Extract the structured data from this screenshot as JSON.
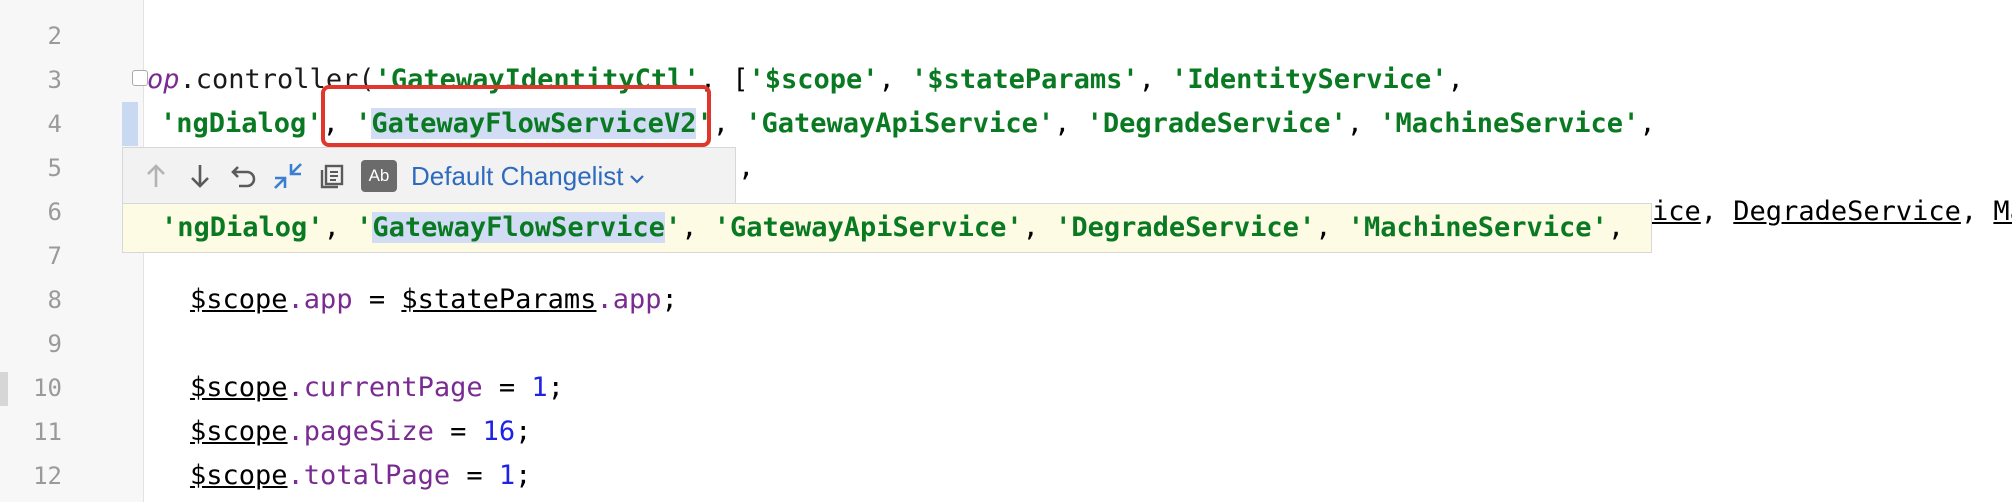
{
  "editor": {
    "line_numbers": [
      "2",
      "3",
      "4",
      "5",
      "6",
      "7",
      "8",
      "9",
      "10",
      "11",
      "12"
    ],
    "line3": {
      "prefix": "op",
      "dot_controller": ".controller(",
      "s1": "'GatewayIdentityCtl'",
      "mid": ", [",
      "s2": "'$scope'",
      "c1": ", ",
      "s3": "'$stateParams'",
      "c2": ", ",
      "s4": "'IdentityService'",
      "tail": ","
    },
    "line4": {
      "s1": "'ngDialog'",
      "c1": ", ",
      "s2_q1": "'",
      "s2_body": "GatewayFlowServiceV2",
      "s2_q2": "'",
      "c2": ", ",
      "s3": "'GatewayApiService'",
      "c3": ", ",
      "s4": "'DegradeService'",
      "c4": ", ",
      "s5": "'MachineService'",
      "tail": ","
    },
    "line5_tail": ",",
    "line6_tail": {
      "t1": "ice",
      "c1": ", ",
      "t2": "DegradeService",
      "c2": ", ",
      "t3": "Ma"
    },
    "line8": {
      "v1": "$scope",
      "p1": ".app",
      "op": " = ",
      "v2": "$stateParams",
      "p2": ".app",
      "end": ";"
    },
    "line10": {
      "v1": "$scope",
      "p1": ".currentPage",
      "op": " = ",
      "n": "1",
      "end": ";"
    },
    "line11": {
      "v1": "$scope",
      "p1": ".pageSize",
      "op": " = ",
      "n": "16",
      "end": ";"
    },
    "line12": {
      "v1": "$scope",
      "p1": ".totalPage",
      "op": " = ",
      "n": "1",
      "end": ";"
    }
  },
  "diff_popup": {
    "toolbar": {
      "icons": [
        "arrow-up-icon",
        "arrow-down-icon",
        "rollback-icon",
        "compare-icon",
        "copy-icon",
        "ab-icon"
      ],
      "ab_label": "Ab",
      "changelist_label": "Default Changelist",
      "changelist_chevron": "⌄"
    },
    "old_line": {
      "s1": "'ngDialog'",
      "c1": ", ",
      "s2_q1": "'",
      "s2_body": "GatewayFlowService",
      "s2_q2": "'",
      "c2": ", ",
      "s3": "'GatewayApiService'",
      "c3": ", ",
      "s4": "'DegradeService'",
      "c4": ", ",
      "s5": "'MachineService'",
      "tail": ","
    }
  },
  "colors": {
    "string": "#0a7a22",
    "property": "#7a2b92",
    "number": "#1e22e6",
    "highlight": "#d2dcf5",
    "annotation_box": "#e0362b",
    "popup_bg": "#fdfbe4",
    "link_blue": "#2e6bbf"
  }
}
